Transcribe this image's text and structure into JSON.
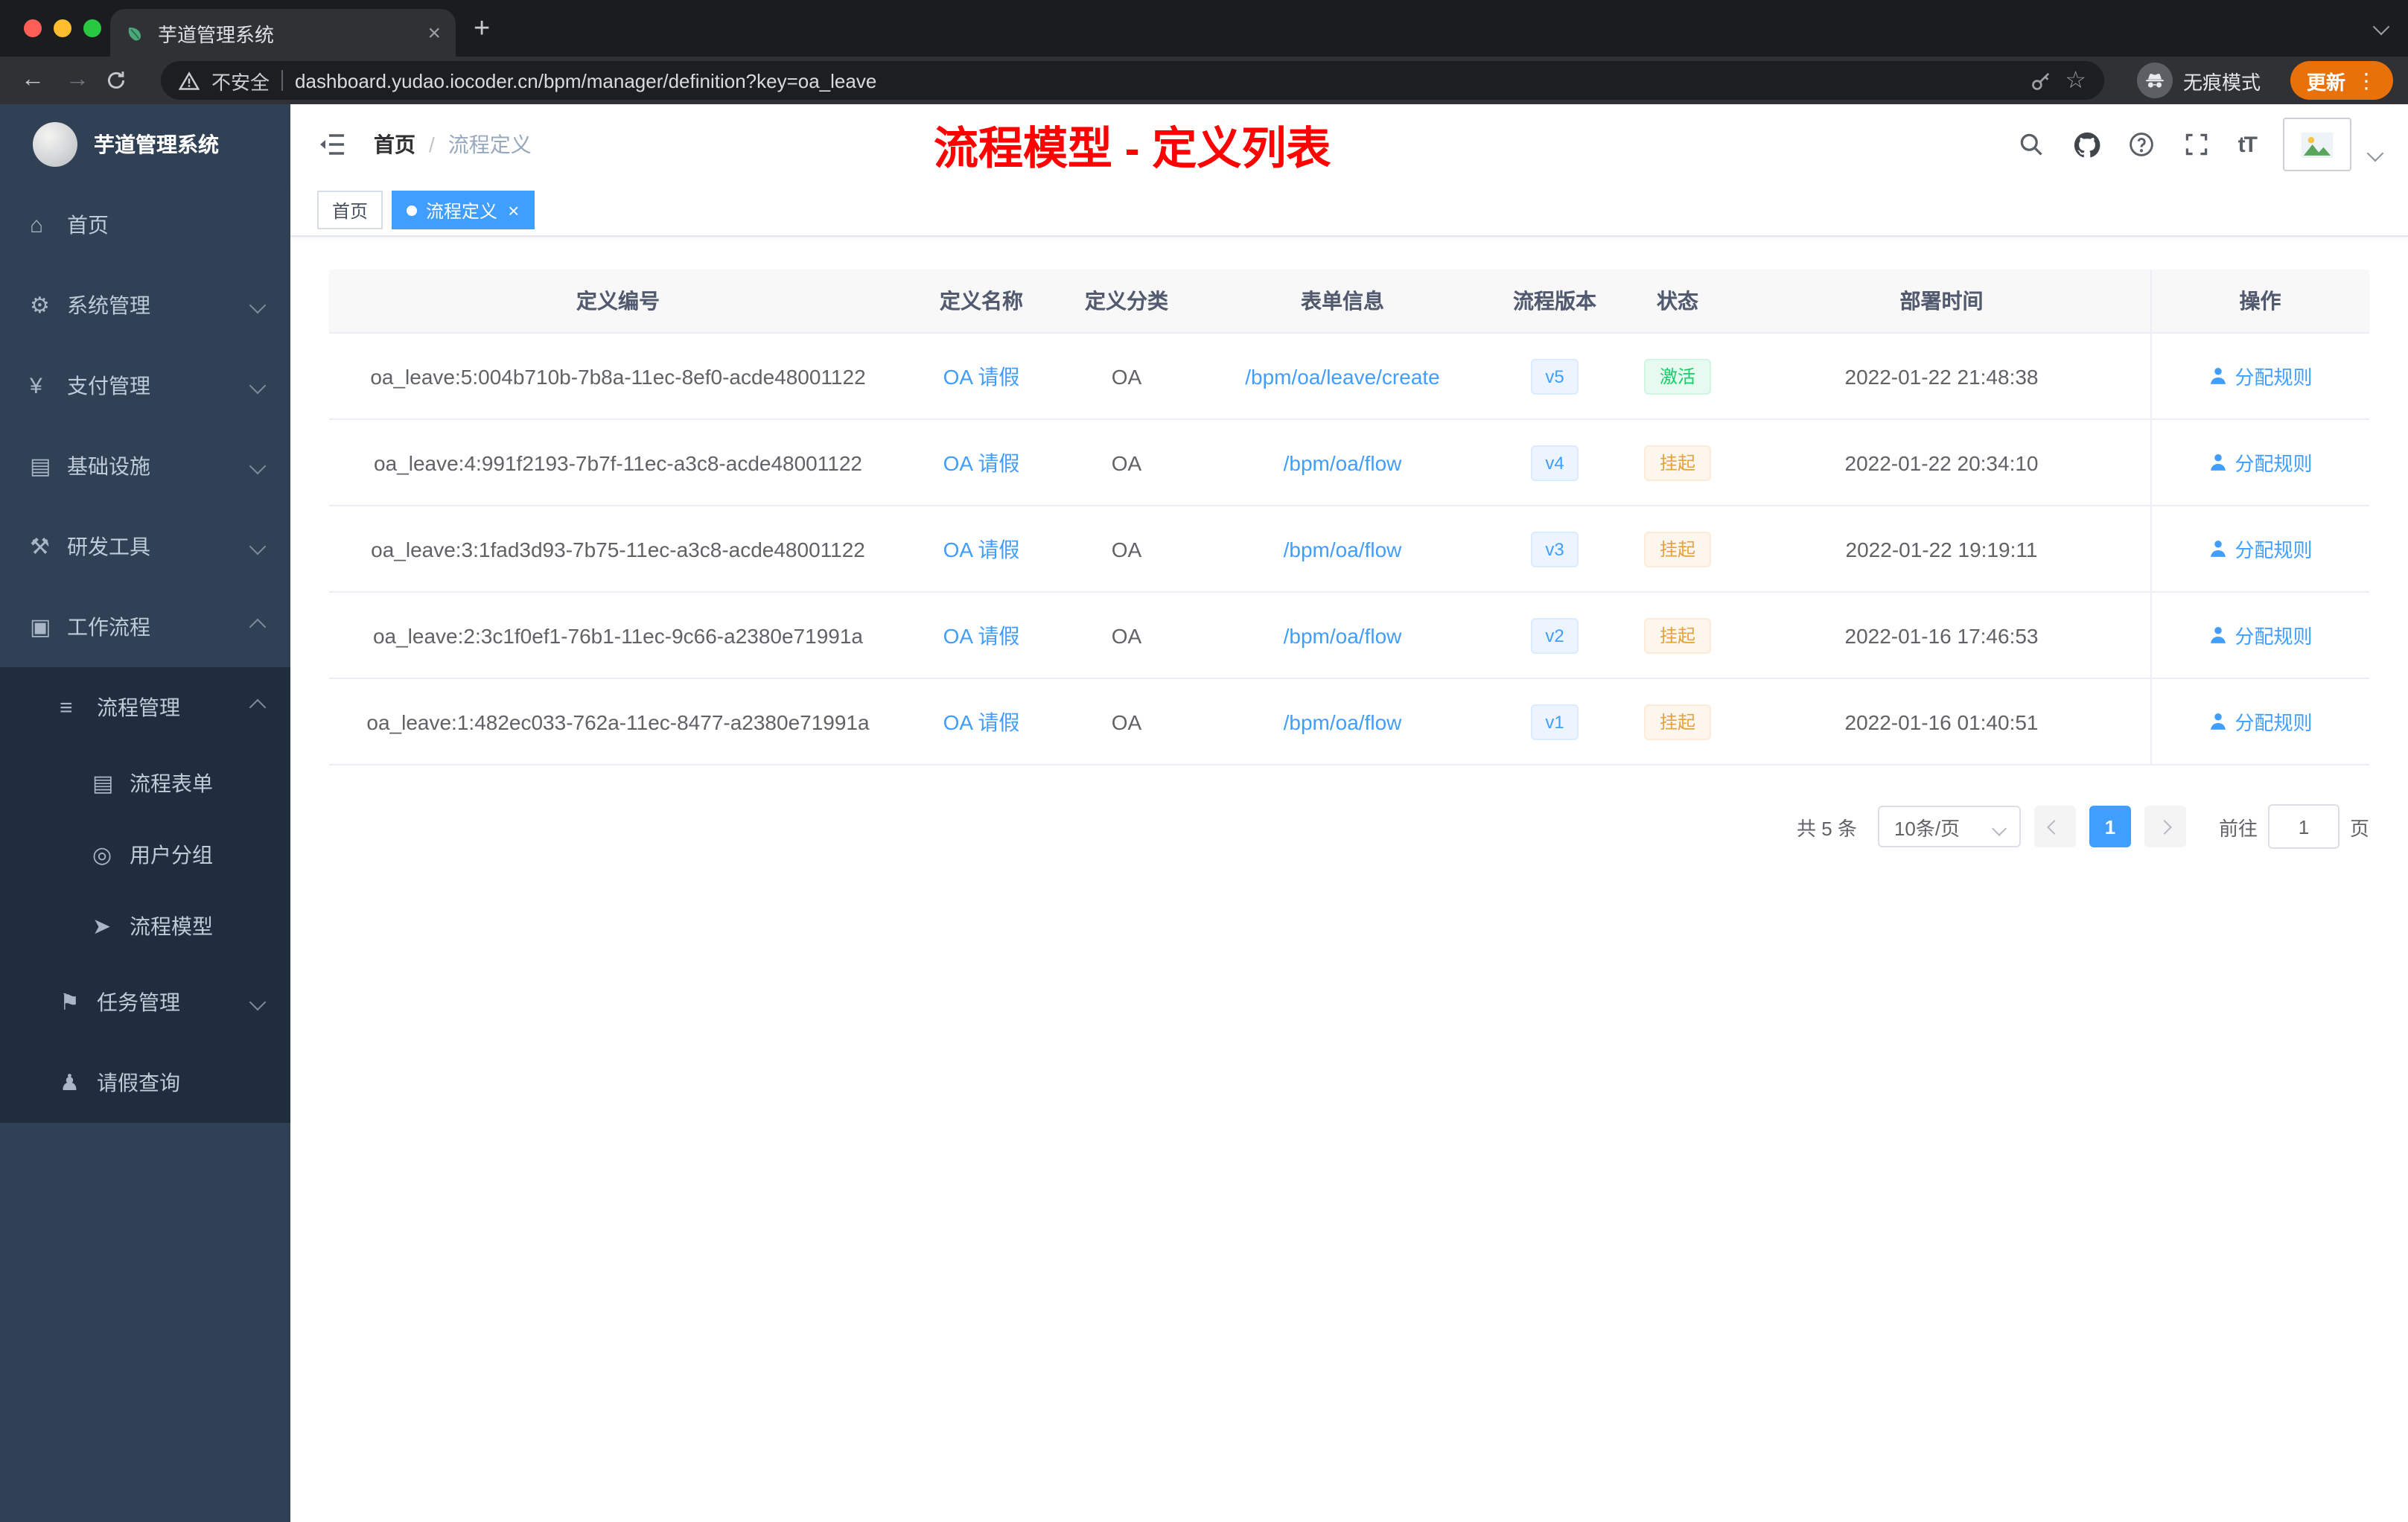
{
  "icons": {
    "back": "←",
    "forward": "→",
    "plus": "+",
    "close": "×",
    "kebab": "⋮",
    "question": "?",
    "font_size": "tT",
    "home": "⌂",
    "gear": "⚙",
    "yen": "¥",
    "infra": "▤",
    "tools": "⚒",
    "workflow": "▣",
    "process": "≡",
    "form": "▤",
    "users": "◎",
    "model": "➤",
    "tasks": "⚑",
    "person": "♟"
  },
  "browser": {
    "tab_title": "芋道管理系统",
    "security_label": "不安全",
    "url": "dashboard.yudao.iocoder.cn/bpm/manager/definition?key=oa_leave",
    "incognito_label": "无痕模式",
    "update_label": "更新"
  },
  "sidebar": {
    "logo_title": "芋道管理系统",
    "items": [
      {
        "label": "首页"
      },
      {
        "label": "系统管理"
      },
      {
        "label": "支付管理"
      },
      {
        "label": "基础设施"
      },
      {
        "label": "研发工具"
      },
      {
        "label": "工作流程"
      },
      {
        "label": "流程管理"
      },
      {
        "label": "流程表单"
      },
      {
        "label": "用户分组"
      },
      {
        "label": "流程模型"
      },
      {
        "label": "任务管理"
      },
      {
        "label": "请假查询"
      }
    ]
  },
  "header": {
    "breadcrumb_home": "首页",
    "breadcrumb_sep": "/",
    "breadcrumb_current": "流程定义",
    "annotation": "流程模型 - 定义列表"
  },
  "tags": {
    "home": "首页",
    "active": "流程定义"
  },
  "table": {
    "columns": [
      "定义编号",
      "定义名称",
      "定义分类",
      "表单信息",
      "流程版本",
      "状态",
      "部署时间",
      "操作"
    ],
    "action_label": "分配规则",
    "rows": [
      {
        "id": "oa_leave:5:004b710b-7b8a-11ec-8ef0-acde48001122",
        "name": "OA 请假",
        "category": "OA",
        "form": "/bpm/oa/leave/create",
        "version": "v5",
        "status": {
          "label": "激活",
          "type": "success"
        },
        "time": "2022-01-22 21:48:38"
      },
      {
        "id": "oa_leave:4:991f2193-7b7f-11ec-a3c8-acde48001122",
        "name": "OA 请假",
        "category": "OA",
        "form": "/bpm/oa/flow",
        "version": "v4",
        "status": {
          "label": "挂起",
          "type": "warning"
        },
        "time": "2022-01-22 20:34:10"
      },
      {
        "id": "oa_leave:3:1fad3d93-7b75-11ec-a3c8-acde48001122",
        "name": "OA 请假",
        "category": "OA",
        "form": "/bpm/oa/flow",
        "version": "v3",
        "status": {
          "label": "挂起",
          "type": "warning"
        },
        "time": "2022-01-22 19:19:11"
      },
      {
        "id": "oa_leave:2:3c1f0ef1-76b1-11ec-9c66-a2380e71991a",
        "name": "OA 请假",
        "category": "OA",
        "form": "/bpm/oa/flow",
        "version": "v2",
        "status": {
          "label": "挂起",
          "type": "warning"
        },
        "time": "2022-01-16 17:46:53"
      },
      {
        "id": "oa_leave:1:482ec033-762a-11ec-8477-a2380e71991a",
        "name": "OA 请假",
        "category": "OA",
        "form": "/bpm/oa/flow",
        "version": "v1",
        "status": {
          "label": "挂起",
          "type": "warning"
        },
        "time": "2022-01-16 01:40:51"
      }
    ]
  },
  "pagination": {
    "total": "共 5 条",
    "page_size": "10条/页",
    "page": "1",
    "goto_label": "前往",
    "goto_value": "1",
    "unit_label": "页"
  },
  "colors": {
    "accent": "#409eff",
    "success": "#13ce66",
    "warning": "#e6a23c",
    "annotation_red": "#fe0100",
    "sidebar_bg": "#304156",
    "submenu_bg": "#1f2d3d"
  }
}
